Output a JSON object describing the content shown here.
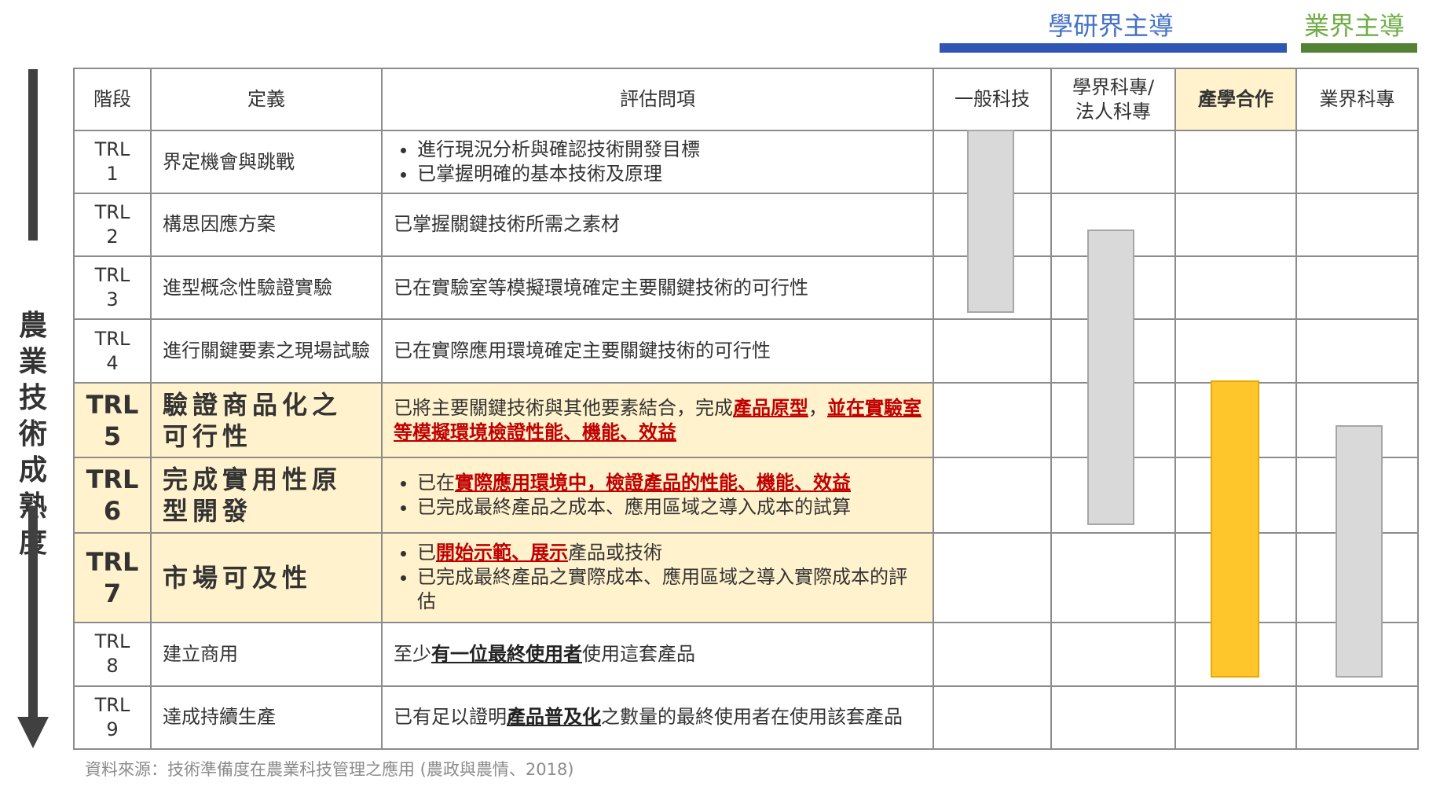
{
  "groups": {
    "academic": {
      "label": "學研界主導",
      "color": "#4472c4",
      "bar_color": "#2f55b5"
    },
    "industry": {
      "label": "業界主導",
      "color": "#70ad47",
      "bar_color": "#548235"
    }
  },
  "side_axis": {
    "label": "農業技術成熟度",
    "color": "#404040"
  },
  "headers": {
    "stage": "階段",
    "definition": "定義",
    "questions": "評估問項",
    "general": "一般科技",
    "academic_line1": "學界科專/",
    "academic_line2": "法人科專",
    "coop": "產學合作",
    "industry": "業界科專"
  },
  "rows": [
    {
      "trl": "TRL",
      "num": "1",
      "definition": "界定機會與跳戰",
      "q1": "進行現況分析與確認技術開發目標",
      "q2": "已掌握明確的基本技術及原理"
    },
    {
      "trl": "TRL",
      "num": "2",
      "definition": "構思因應方案",
      "q": "已掌握關鍵技術所需之素材"
    },
    {
      "trl": "TRL",
      "num": "3",
      "definition": "進型概念性驗證實驗",
      "q": "已在實驗室等模擬環境確定主要關鍵技術的可行性"
    },
    {
      "trl": "TRL",
      "num": "4",
      "definition": "進行關鍵要素之現場試驗",
      "q": "已在實際應用環境確定主要關鍵技術的可行性"
    },
    {
      "trl": "TRL",
      "num": "5",
      "definition": "驗證商品化之可行性",
      "q_a": "已將主要關鍵技術與其他要素結合，完成",
      "q_b": "產品原型",
      "q_c": "，",
      "q_d": "並在實驗室等模擬環境檢證性能、機能、效益"
    },
    {
      "trl": "TRL",
      "num": "6",
      "definition": "完成實用性原型開發",
      "q1_a": "已在",
      "q1_b": "實際應用環境中，檢證產品的性能、機能、效益",
      "q2": "已完成最終產品之成本、應用區域之導入成本的試算"
    },
    {
      "trl": "TRL",
      "num": "7",
      "definition": "市場可及性",
      "q1_a": "已",
      "q1_b": "開始示範、展示",
      "q1_c": "產品或技術",
      "q2": "已完成最終產品之實際成本、應用區域之導入實際成本的評估"
    },
    {
      "trl": "TRL",
      "num": "8",
      "definition": "建立商用",
      "q_a": "至少",
      "q_b": "有一位最終使用者",
      "q_c": "使用這套產品"
    },
    {
      "trl": "TRL",
      "num": "9",
      "definition": "達成持續生產",
      "q_a": "已有足以證明",
      "q_b": "產品普及化",
      "q_c": "之數量的最終使用者在使用該套產品"
    }
  ],
  "bars": {
    "general": {
      "from_trl": 1,
      "to_trl": 3,
      "color": "#d9d9d9"
    },
    "academic": {
      "from_trl": 2.6,
      "to_trl": 6,
      "color": "#d9d9d9"
    },
    "coop": {
      "from_trl": 5,
      "to_trl": 8,
      "color": "#ffc62c"
    },
    "industry": {
      "from_trl": 5.6,
      "to_trl": 9,
      "color": "#d9d9d9"
    }
  },
  "highlight_color": "#fff2cc",
  "source": "資料來源：技術準備度在農業科技管理之應用 (農政與農情、2018)"
}
